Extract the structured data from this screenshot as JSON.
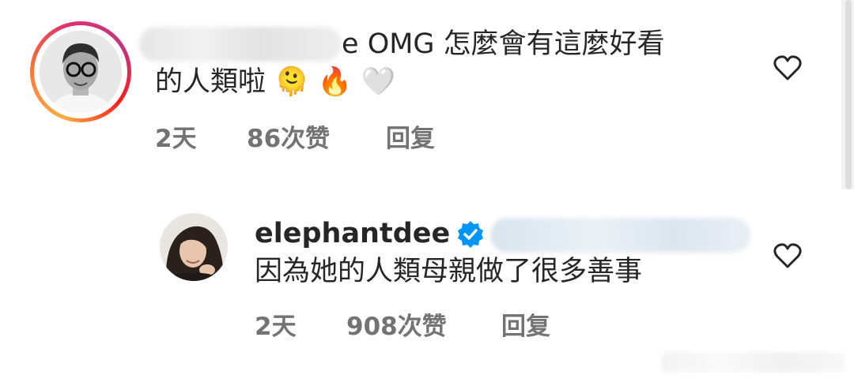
{
  "comments": [
    {
      "username_visible_suffix": "e",
      "text_line1": "OMG 怎麼會有這麼好看",
      "text_line2": "的人類啦",
      "emojis": [
        "🫠",
        "🔥",
        "🤍"
      ],
      "time": "2天",
      "likes": "86次赞",
      "reply_label": "回复",
      "avatar_icon": "man-with-glasses-avatar",
      "like_icon": "heart-outline-icon"
    },
    {
      "username": "elephantdee",
      "verified": true,
      "text": "因為她的人類母親做了很多善事",
      "time": "2天",
      "likes": "908次赞",
      "reply_label": "回复",
      "avatar_icon": "woman-avatar",
      "like_icon": "heart-outline-icon"
    }
  ],
  "colors": {
    "text": "#262626",
    "meta": "#737373",
    "verified_blue": "#0095f6",
    "story_ring": [
      "#fcaf45",
      "#e1306c",
      "#c13584"
    ]
  }
}
